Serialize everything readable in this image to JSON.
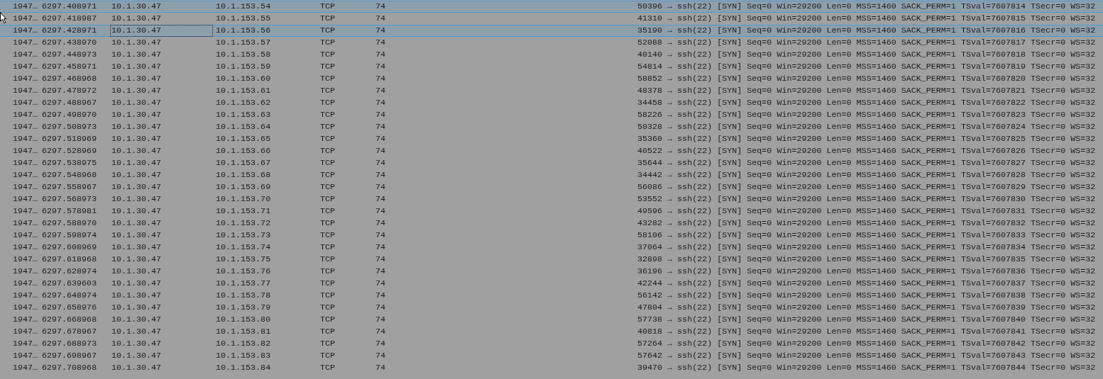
{
  "packet_list": {
    "rows": [
      {
        "no": "1947…",
        "time": "6297.408971",
        "source": "10.1.30.47",
        "destination": "10.1.153.54",
        "protocol": "TCP",
        "length": "74",
        "info": "50396 → ssh(22) [SYN] Seq=0 Win=29200 Len=0 MSS=1460 SACK_PERM=1 TSval=7607814 TSecr=0 WS=32",
        "selected": true,
        "focused": false
      },
      {
        "no": "1947…",
        "time": "6297.418987",
        "source": "10.1.30.47",
        "destination": "10.1.153.55",
        "protocol": "TCP",
        "length": "74",
        "info": "41310 → ssh(22) [SYN] Seq=0 Win=29200 Len=0 MSS=1460 SACK_PERM=1 TSval=7607815 TSecr=0 WS=32",
        "selected": false,
        "focused": false
      },
      {
        "no": "1947…",
        "time": "6297.428971",
        "source": "10.1.30.47",
        "destination": "10.1.153.56",
        "protocol": "TCP",
        "length": "74",
        "info": "35190 → ssh(22) [SYN] Seq=0 Win=29200 Len=0 MSS=1460 SACK_PERM=1 TSval=7607816 TSecr=0 WS=32",
        "selected": true,
        "focused": true
      },
      {
        "no": "1947…",
        "time": "6297.438970",
        "source": "10.1.30.47",
        "destination": "10.1.153.57",
        "protocol": "TCP",
        "length": "74",
        "info": "52088 → ssh(22) [SYN] Seq=0 Win=29200 Len=0 MSS=1460 SACK_PERM=1 TSval=7607817 TSecr=0 WS=32",
        "selected": false,
        "focused": false
      },
      {
        "no": "1947…",
        "time": "6297.448973",
        "source": "10.1.30.47",
        "destination": "10.1.153.58",
        "protocol": "TCP",
        "length": "74",
        "info": "40140 → ssh(22) [SYN] Seq=0 Win=29200 Len=0 MSS=1460 SACK_PERM=1 TSval=7607818 TSecr=0 WS=32",
        "selected": false,
        "focused": false
      },
      {
        "no": "1947…",
        "time": "6297.458971",
        "source": "10.1.30.47",
        "destination": "10.1.153.59",
        "protocol": "TCP",
        "length": "74",
        "info": "54814 → ssh(22) [SYN] Seq=0 Win=29200 Len=0 MSS=1460 SACK_PERM=1 TSval=7607819 TSecr=0 WS=32",
        "selected": false,
        "focused": false
      },
      {
        "no": "1947…",
        "time": "6297.468968",
        "source": "10.1.30.47",
        "destination": "10.1.153.60",
        "protocol": "TCP",
        "length": "74",
        "info": "58852 → ssh(22) [SYN] Seq=0 Win=29200 Len=0 MSS=1460 SACK_PERM=1 TSval=7607820 TSecr=0 WS=32",
        "selected": false,
        "focused": false
      },
      {
        "no": "1947…",
        "time": "6297.478972",
        "source": "10.1.30.47",
        "destination": "10.1.153.61",
        "protocol": "TCP",
        "length": "74",
        "info": "48378 → ssh(22) [SYN] Seq=0 Win=29200 Len=0 MSS=1460 SACK_PERM=1 TSval=7607821 TSecr=0 WS=32",
        "selected": false,
        "focused": false
      },
      {
        "no": "1947…",
        "time": "6297.488967",
        "source": "10.1.30.47",
        "destination": "10.1.153.62",
        "protocol": "TCP",
        "length": "74",
        "info": "34458 → ssh(22) [SYN] Seq=0 Win=29200 Len=0 MSS=1460 SACK_PERM=1 TSval=7607822 TSecr=0 WS=32",
        "selected": false,
        "focused": false
      },
      {
        "no": "1947…",
        "time": "6297.498970",
        "source": "10.1.30.47",
        "destination": "10.1.153.63",
        "protocol": "TCP",
        "length": "74",
        "info": "58226 → ssh(22) [SYN] Seq=0 Win=29200 Len=0 MSS=1460 SACK_PERM=1 TSval=7607823 TSecr=0 WS=32",
        "selected": false,
        "focused": false
      },
      {
        "no": "1947…",
        "time": "6297.508973",
        "source": "10.1.30.47",
        "destination": "10.1.153.64",
        "protocol": "TCP",
        "length": "74",
        "info": "50328 → ssh(22) [SYN] Seq=0 Win=29200 Len=0 MSS=1460 SACK_PERM=1 TSval=7607824 TSecr=0 WS=32",
        "selected": false,
        "focused": false
      },
      {
        "no": "1947…",
        "time": "6297.518969",
        "source": "10.1.30.47",
        "destination": "10.1.153.65",
        "protocol": "TCP",
        "length": "74",
        "info": "35360 → ssh(22) [SYN] Seq=0 Win=29200 Len=0 MSS=1460 SACK_PERM=1 TSval=7607825 TSecr=0 WS=32",
        "selected": false,
        "focused": false
      },
      {
        "no": "1947…",
        "time": "6297.528969",
        "source": "10.1.30.47",
        "destination": "10.1.153.66",
        "protocol": "TCP",
        "length": "74",
        "info": "40522 → ssh(22) [SYN] Seq=0 Win=29200 Len=0 MSS=1460 SACK_PERM=1 TSval=7607826 TSecr=0 WS=32",
        "selected": false,
        "focused": false
      },
      {
        "no": "1947…",
        "time": "6297.538975",
        "source": "10.1.30.47",
        "destination": "10.1.153.67",
        "protocol": "TCP",
        "length": "74",
        "info": "35644 → ssh(22) [SYN] Seq=0 Win=29200 Len=0 MSS=1460 SACK_PERM=1 TSval=7607827 TSecr=0 WS=32",
        "selected": false,
        "focused": false
      },
      {
        "no": "1947…",
        "time": "6297.548968",
        "source": "10.1.30.47",
        "destination": "10.1.153.68",
        "protocol": "TCP",
        "length": "74",
        "info": "34442 → ssh(22) [SYN] Seq=0 Win=29200 Len=0 MSS=1460 SACK_PERM=1 TSval=7607828 TSecr=0 WS=32",
        "selected": false,
        "focused": false
      },
      {
        "no": "1947…",
        "time": "6297.558967",
        "source": "10.1.30.47",
        "destination": "10.1.153.69",
        "protocol": "TCP",
        "length": "74",
        "info": "56086 → ssh(22) [SYN] Seq=0 Win=29200 Len=0 MSS=1460 SACK_PERM=1 TSval=7607829 TSecr=0 WS=32",
        "selected": false,
        "focused": false
      },
      {
        "no": "1947…",
        "time": "6297.568973",
        "source": "10.1.30.47",
        "destination": "10.1.153.70",
        "protocol": "TCP",
        "length": "74",
        "info": "53552 → ssh(22) [SYN] Seq=0 Win=29200 Len=0 MSS=1460 SACK_PERM=1 TSval=7607830 TSecr=0 WS=32",
        "selected": false,
        "focused": false
      },
      {
        "no": "1947…",
        "time": "6297.578981",
        "source": "10.1.30.47",
        "destination": "10.1.153.71",
        "protocol": "TCP",
        "length": "74",
        "info": "49596 → ssh(22) [SYN] Seq=0 Win=29200 Len=0 MSS=1460 SACK_PERM=1 TSval=7607831 TSecr=0 WS=32",
        "selected": false,
        "focused": false
      },
      {
        "no": "1947…",
        "time": "6297.588970",
        "source": "10.1.30.47",
        "destination": "10.1.153.72",
        "protocol": "TCP",
        "length": "74",
        "info": "43282 → ssh(22) [SYN] Seq=0 Win=29200 Len=0 MSS=1460 SACK_PERM=1 TSval=7607832 TSecr=0 WS=32",
        "selected": false,
        "focused": false
      },
      {
        "no": "1947…",
        "time": "6297.598974",
        "source": "10.1.30.47",
        "destination": "10.1.153.73",
        "protocol": "TCP",
        "length": "74",
        "info": "58106 → ssh(22) [SYN] Seq=0 Win=29200 Len=0 MSS=1460 SACK_PERM=1 TSval=7607833 TSecr=0 WS=32",
        "selected": false,
        "focused": false
      },
      {
        "no": "1947…",
        "time": "6297.608969",
        "source": "10.1.30.47",
        "destination": "10.1.153.74",
        "protocol": "TCP",
        "length": "74",
        "info": "37064 → ssh(22) [SYN] Seq=0 Win=29200 Len=0 MSS=1460 SACK_PERM=1 TSval=7607834 TSecr=0 WS=32",
        "selected": false,
        "focused": false
      },
      {
        "no": "1947…",
        "time": "6297.618968",
        "source": "10.1.30.47",
        "destination": "10.1.153.75",
        "protocol": "TCP",
        "length": "74",
        "info": "32898 → ssh(22) [SYN] Seq=0 Win=29200 Len=0 MSS=1460 SACK_PERM=1 TSval=7607835 TSecr=0 WS=32",
        "selected": false,
        "focused": false
      },
      {
        "no": "1947…",
        "time": "6297.628974",
        "source": "10.1.30.47",
        "destination": "10.1.153.76",
        "protocol": "TCP",
        "length": "74",
        "info": "36196 → ssh(22) [SYN] Seq=0 Win=29200 Len=0 MSS=1460 SACK_PERM=1 TSval=7607836 TSecr=0 WS=32",
        "selected": false,
        "focused": false
      },
      {
        "no": "1947…",
        "time": "6297.639603",
        "source": "10.1.30.47",
        "destination": "10.1.153.77",
        "protocol": "TCP",
        "length": "74",
        "info": "42244 → ssh(22) [SYN] Seq=0 Win=29200 Len=0 MSS=1460 SACK_PERM=1 TSval=7607837 TSecr=0 WS=32",
        "selected": false,
        "focused": false
      },
      {
        "no": "1947…",
        "time": "6297.648974",
        "source": "10.1.30.47",
        "destination": "10.1.153.78",
        "protocol": "TCP",
        "length": "74",
        "info": "56142 → ssh(22) [SYN] Seq=0 Win=29200 Len=0 MSS=1460 SACK_PERM=1 TSval=7607838 TSecr=0 WS=32",
        "selected": false,
        "focused": false
      },
      {
        "no": "1947…",
        "time": "6297.658976",
        "source": "10.1.30.47",
        "destination": "10.1.153.79",
        "protocol": "TCP",
        "length": "74",
        "info": "47804 → ssh(22) [SYN] Seq=0 Win=29200 Len=0 MSS=1460 SACK_PERM=1 TSval=7607839 TSecr=0 WS=32",
        "selected": false,
        "focused": false
      },
      {
        "no": "1947…",
        "time": "6297.668968",
        "source": "10.1.30.47",
        "destination": "10.1.153.80",
        "protocol": "TCP",
        "length": "74",
        "info": "57738 → ssh(22) [SYN] Seq=0 Win=29200 Len=0 MSS=1460 SACK_PERM=1 TSval=7607840 TSecr=0 WS=32",
        "selected": false,
        "focused": false
      },
      {
        "no": "1947…",
        "time": "6297.678967",
        "source": "10.1.30.47",
        "destination": "10.1.153.81",
        "protocol": "TCP",
        "length": "74",
        "info": "40818 → ssh(22) [SYN] Seq=0 Win=29200 Len=0 MSS=1460 SACK_PERM=1 TSval=7607841 TSecr=0 WS=32",
        "selected": false,
        "focused": false
      },
      {
        "no": "1947…",
        "time": "6297.688973",
        "source": "10.1.30.47",
        "destination": "10.1.153.82",
        "protocol": "TCP",
        "length": "74",
        "info": "57264 → ssh(22) [SYN] Seq=0 Win=29200 Len=0 MSS=1460 SACK_PERM=1 TSval=7607842 TSecr=0 WS=32",
        "selected": false,
        "focused": false
      },
      {
        "no": "1947…",
        "time": "6297.698967",
        "source": "10.1.30.47",
        "destination": "10.1.153.83",
        "protocol": "TCP",
        "length": "74",
        "info": "57642 → ssh(22) [SYN] Seq=0 Win=29200 Len=0 MSS=1460 SACK_PERM=1 TSval=7607843 TSecr=0 WS=32",
        "selected": false,
        "focused": false
      },
      {
        "no": "1947…",
        "time": "6297.708968",
        "source": "10.1.30.47",
        "destination": "10.1.153.84",
        "protocol": "TCP",
        "length": "74",
        "info": "39470 → ssh(22) [SYN] Seq=0 Win=29200 Len=0 MSS=1460 SACK_PERM=1 TSval=7607844 TSecr=0 WS=32",
        "selected": false,
        "focused": false
      }
    ]
  }
}
